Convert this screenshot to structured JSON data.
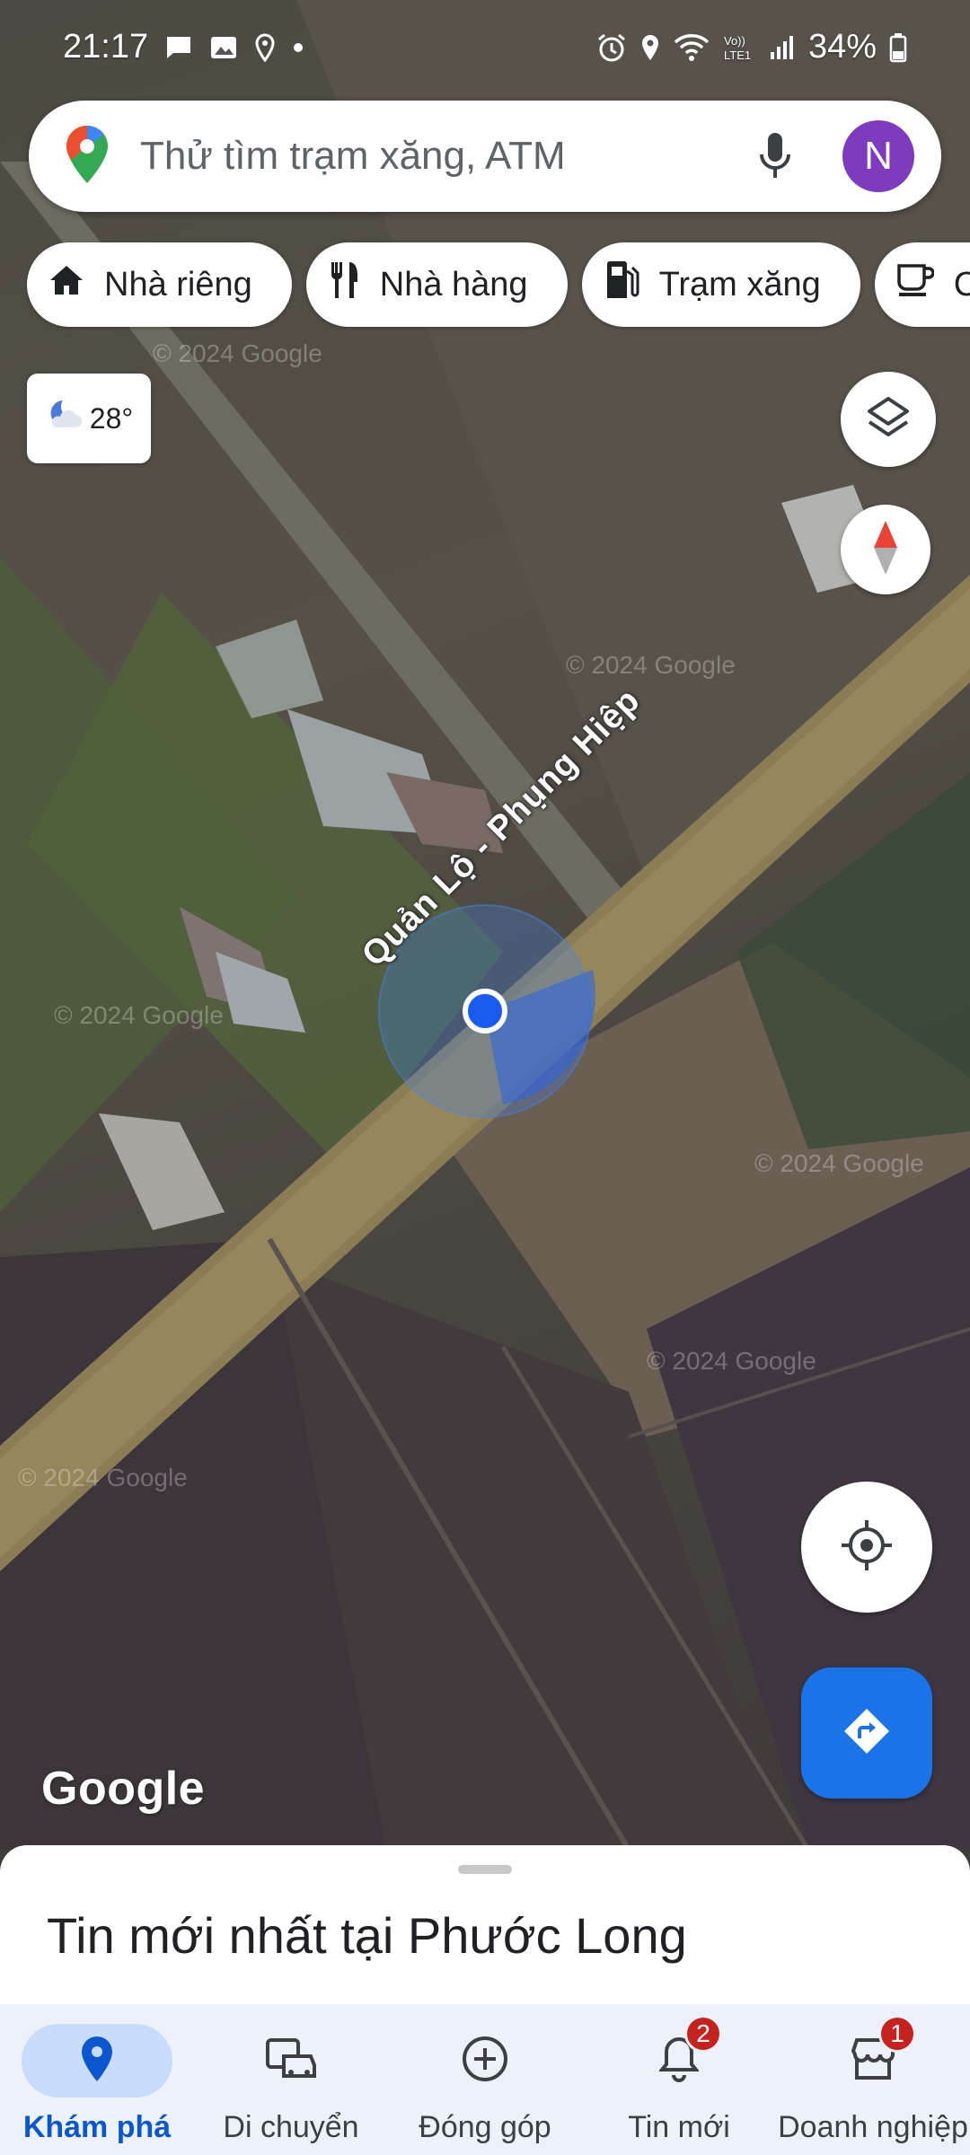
{
  "status_bar": {
    "time": "21:17",
    "battery": "34%",
    "left_icons": [
      "message-icon",
      "image-icon",
      "location-icon",
      "dot-icon"
    ],
    "right_icons": [
      "alarm-icon",
      "location-icon",
      "wifi-icon",
      "volte-icon",
      "signal-icon",
      "battery-icon"
    ]
  },
  "search": {
    "placeholder": "Thử tìm trạm xăng, ATM",
    "avatar_letter": "N",
    "avatar_color": "#7e3bbf"
  },
  "chips": [
    {
      "label": "Nhà riêng",
      "icon": "home-icon"
    },
    {
      "label": "Nhà hàng",
      "icon": "restaurant-icon"
    },
    {
      "label": "Trạm xăng",
      "icon": "gas-station-icon"
    },
    {
      "label": "C",
      "icon": "coffee-icon"
    }
  ],
  "weather": {
    "temperature": "28°",
    "icon": "night-cloudy-icon"
  },
  "map": {
    "road_name": "Quản Lộ - Phụng Hiệp",
    "watermark": "© 2024 Google",
    "logo": "Google"
  },
  "sheet": {
    "title": "Tin mới nhất tại Phước Long"
  },
  "bottom_nav": [
    {
      "label": "Khám phá",
      "icon": "explore-pin-icon",
      "active": true,
      "badge": ""
    },
    {
      "label": "Di chuyển",
      "icon": "commute-icon",
      "active": false,
      "badge": ""
    },
    {
      "label": "Đóng góp",
      "icon": "contribute-icon",
      "active": false,
      "badge": ""
    },
    {
      "label": "Tin mới",
      "icon": "notifications-icon",
      "active": false,
      "badge": "2"
    },
    {
      "label": "Doanh nghiệp",
      "icon": "business-icon",
      "active": false,
      "badge": "1"
    }
  ],
  "colors": {
    "accent": "#1a73e8",
    "active_nav": "#0b57d0",
    "badge": "#c5221f"
  }
}
